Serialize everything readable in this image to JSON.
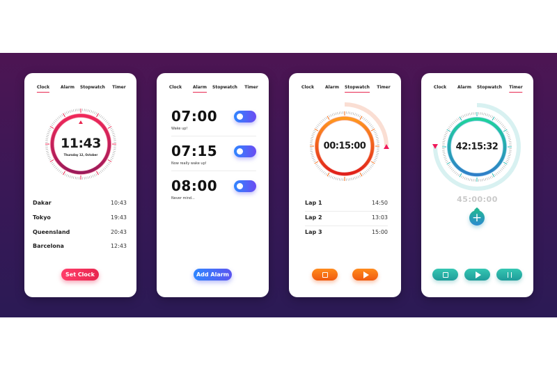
{
  "tabs": [
    "Clock",
    "Alarm",
    "Stopwatch",
    "Timer"
  ],
  "clock_screen": {
    "active_tab": "Clock",
    "time": "11:43",
    "date": "Thursday 12, October",
    "cities": [
      {
        "name": "Dakar",
        "time": "10:43"
      },
      {
        "name": "Tokyo",
        "time": "19:43"
      },
      {
        "name": "Queensland",
        "time": "20:43"
      },
      {
        "name": "Barcelona",
        "time": "12:43"
      }
    ],
    "button_label": "Set Clock",
    "accent_color": "#e8264f"
  },
  "alarm_screen": {
    "active_tab": "Alarm",
    "alarms": [
      {
        "time": "07:00",
        "label": "Wake up!",
        "toggle_icon": "toggle-switch"
      },
      {
        "time": "07:15",
        "label": "Now really wake up!",
        "toggle_icon": "toggle-switch"
      },
      {
        "time": "08:00",
        "label": "Never mind...",
        "toggle_icon": "toggle-switch"
      }
    ],
    "button_label": "Add Alarm",
    "accent_color": "#4a6cf5"
  },
  "stopwatch_screen": {
    "active_tab": "Stopwatch",
    "time": "00:15:00",
    "progress_fraction": 0.25,
    "laps": [
      {
        "name": "Lap 1",
        "time": "14:50"
      },
      {
        "name": "Lap 2",
        "time": "13:03"
      },
      {
        "name": "Lap 3",
        "time": "15:00"
      }
    ],
    "controls": [
      "stop-icon",
      "play-icon"
    ],
    "accent_color": "#f26a14"
  },
  "timer_screen": {
    "active_tab": "Timer",
    "time": "42:15:32",
    "total": "45:00:00",
    "progress_fraction": 0.75,
    "add_icon": "plus-icon",
    "controls": [
      "stop-icon",
      "play-icon",
      "pause-icon"
    ],
    "accent_color": "#26b09a"
  }
}
